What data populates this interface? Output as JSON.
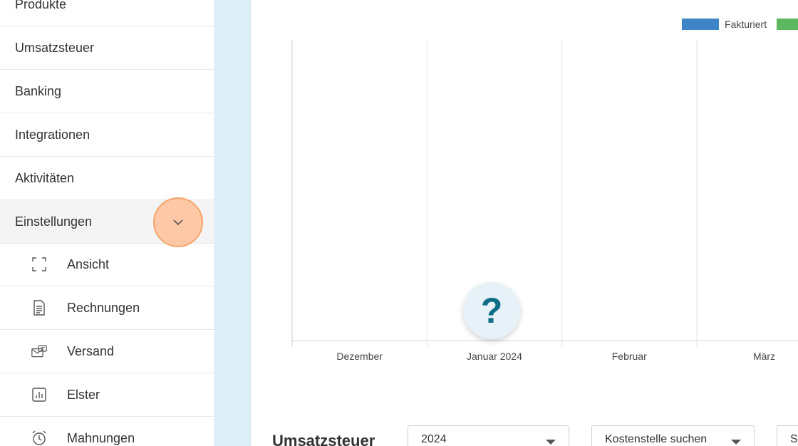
{
  "sidebar": {
    "items": [
      {
        "label": "Produkte"
      },
      {
        "label": "Umsatzsteuer"
      },
      {
        "label": "Banking"
      },
      {
        "label": "Integrationen"
      },
      {
        "label": "Aktivitäten"
      },
      {
        "label": "Einstellungen"
      }
    ],
    "sub_items": [
      {
        "label": "Ansicht",
        "icon": "fullscreen-icon"
      },
      {
        "label": "Rechnungen",
        "icon": "document-icon"
      },
      {
        "label": "Versand",
        "icon": "mail-icon"
      },
      {
        "label": "Elster",
        "icon": "chart-icon"
      },
      {
        "label": "Mahnungen",
        "icon": "alarm-clock-icon"
      }
    ]
  },
  "chart_data": {
    "type": "bar",
    "categories": [
      "Dezember",
      "Januar 2024",
      "Februar",
      "März"
    ],
    "series": [
      {
        "name": "Fakturiert",
        "color": "#3d85c6",
        "values": [
          0,
          0,
          0,
          0
        ]
      },
      {
        "name": "",
        "color": "#5cb85c",
        "values": [
          0,
          0,
          0,
          0
        ]
      }
    ],
    "title": "",
    "xlabel": "",
    "ylabel": "",
    "grid": true,
    "legend": "top-right"
  },
  "main": {
    "help_label": "?",
    "section_title": "Umsatzsteuer",
    "year_select": "2024",
    "cost_center_placeholder": "Kostenstelle suchen",
    "third_select": "S"
  },
  "colors": {
    "accent_orange": "#f5a66a",
    "help_color": "#0f6e86"
  }
}
